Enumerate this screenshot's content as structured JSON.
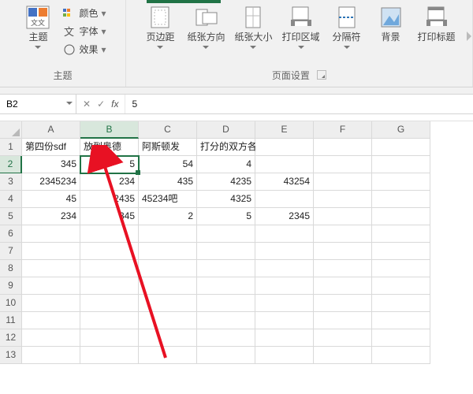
{
  "ribbon": {
    "themes_group_label": "主题",
    "page_setup_group_label": "页面设置",
    "theme_btn": "主题",
    "colors": "颜色",
    "fonts": "字体",
    "effects": "效果",
    "margins": "页边距",
    "orientation": "纸张方向",
    "size": "纸张大小",
    "print_area": "打印区域",
    "breaks": "分隔符",
    "background": "背景",
    "print_titles": "打印标题"
  },
  "formula_bar": {
    "name_box": "B2",
    "fx_label": "fx",
    "formula_value": "5"
  },
  "columns": [
    "A",
    "B",
    "C",
    "D",
    "E",
    "F",
    "G"
  ],
  "row_headers": [
    "1",
    "2",
    "3",
    "4",
    "5",
    "6",
    "7",
    "8",
    "9",
    "10",
    "11",
    "12",
    "13"
  ],
  "active": {
    "col": "B",
    "row": "2"
  },
  "cells": {
    "r1": {
      "A": "第四份sdf",
      "B": "放到奥德",
      "C": "阿斯顿发",
      "D": "打分的双方各"
    },
    "r2": {
      "A": "345",
      "B": "5",
      "C": "54",
      "D": "4"
    },
    "r3": {
      "A": "2345234",
      "B": "234",
      "C": "435",
      "D": "4235",
      "E": "43254"
    },
    "r4": {
      "A": "45",
      "B": "2435",
      "C": "45234吧",
      "D": "4325"
    },
    "r5": {
      "A": "234",
      "B": "345",
      "C": "2",
      "D": "5",
      "E": "2345"
    }
  }
}
